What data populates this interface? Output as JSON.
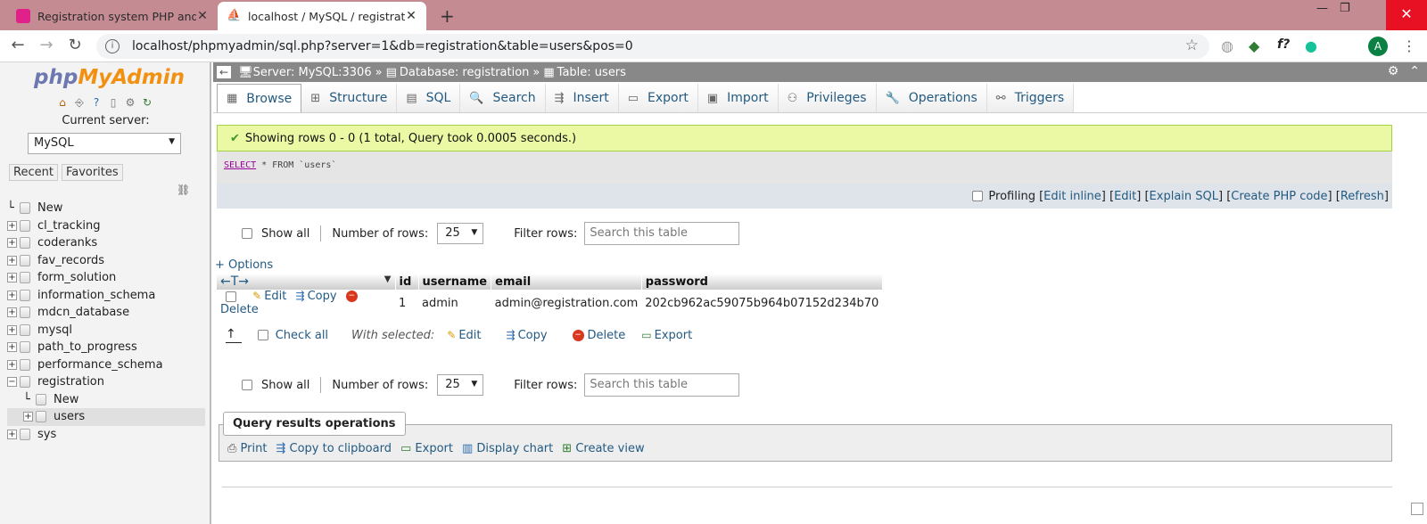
{
  "browser": {
    "tabs": [
      {
        "title": "Registration system PHP and My",
        "active": false
      },
      {
        "title": "localhost / MySQL / registration",
        "active": true
      }
    ],
    "url": "localhost/phpmyadmin/sql.php?server=1&db=registration&table=users&pos=0",
    "avatar_letter": "A",
    "ext_f": "f?"
  },
  "nav": {
    "logo_php": "php",
    "logo_myadmin": "MyAdmin",
    "current_server_label": "Current server:",
    "server_select": "MySQL",
    "tabs": [
      "Recent",
      "Favorites"
    ],
    "tree": [
      {
        "label": "New",
        "type": "new"
      },
      {
        "label": "cl_tracking",
        "type": "db"
      },
      {
        "label": "coderanks",
        "type": "db"
      },
      {
        "label": "fav_records",
        "type": "db"
      },
      {
        "label": "form_solution",
        "type": "db"
      },
      {
        "label": "information_schema",
        "type": "db"
      },
      {
        "label": "mdcn_database",
        "type": "db"
      },
      {
        "label": "mysql",
        "type": "db"
      },
      {
        "label": "path_to_progress",
        "type": "db"
      },
      {
        "label": "performance_schema",
        "type": "db"
      },
      {
        "label": "registration",
        "type": "db-open"
      },
      {
        "label": "New",
        "type": "child-new"
      },
      {
        "label": "users",
        "type": "child-table"
      },
      {
        "label": "sys",
        "type": "db"
      }
    ]
  },
  "breadcrumb": {
    "server": "Server: MySQL:3306",
    "database": "Database: registration",
    "table": "Table: users",
    "sep": "»"
  },
  "toptabs": [
    "Browse",
    "Structure",
    "SQL",
    "Search",
    "Insert",
    "Export",
    "Import",
    "Privileges",
    "Operations",
    "Triggers"
  ],
  "result": {
    "success_msg": "Showing rows 0 - 0 (1 total, Query took 0.0005 seconds.)",
    "sql_keyword": "SELECT",
    "sql_rest": " * FROM `users`",
    "profiling": "Profiling",
    "links": [
      "Edit inline",
      "Edit",
      "Explain SQL",
      "Create PHP code",
      "Refresh"
    ]
  },
  "paging": {
    "show_all": "Show all",
    "number_of_rows": "Number of rows:",
    "rows_value": "25",
    "filter_rows": "Filter rows:",
    "filter_placeholder": "Search this table"
  },
  "options_link": "+ Options",
  "table": {
    "arrows": "←T→",
    "headers": [
      "id",
      "username",
      "email",
      "password"
    ],
    "rows": [
      {
        "edit": "Edit",
        "copy": "Copy",
        "delete": "Delete",
        "id": "1",
        "username": "admin",
        "email": "admin@registration.com",
        "password": "202cb962ac59075b964b07152d234b70"
      }
    ]
  },
  "with_selected": {
    "check_all": "Check all",
    "label": "With selected:",
    "actions": [
      "Edit",
      "Copy",
      "Delete",
      "Export"
    ]
  },
  "qro": {
    "legend": "Query results operations",
    "links": [
      "Print",
      "Copy to clipboard",
      "Export",
      "Display chart",
      "Create view"
    ]
  }
}
